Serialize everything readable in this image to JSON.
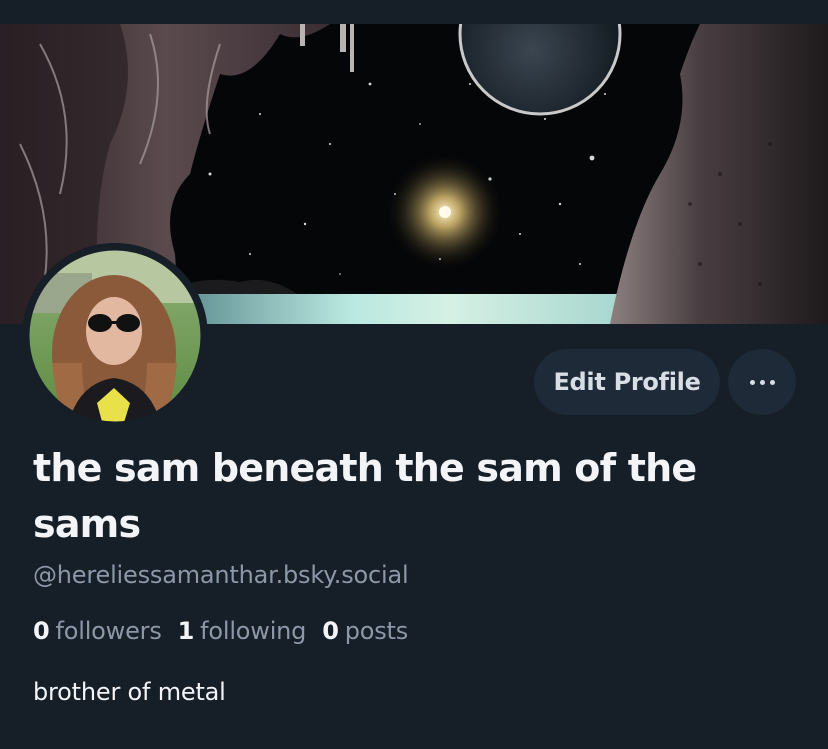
{
  "profile": {
    "display_name": "the sam beneath the sam of the sams",
    "handle": "@hereliessamanthar.bsky.social",
    "bio": "brother of metal"
  },
  "stats": {
    "followers_count": "0",
    "followers_label": "followers",
    "following_count": "1",
    "following_label": "following",
    "posts_count": "0",
    "posts_label": "posts"
  },
  "actions": {
    "edit_profile_label": "Edit Profile",
    "more_icon": "more-horizontal-icon"
  },
  "colors": {
    "background": "#161e27",
    "button_bg": "#1e2a37",
    "text_primary": "#f2f4f7",
    "text_secondary": "#8c98a8"
  }
}
